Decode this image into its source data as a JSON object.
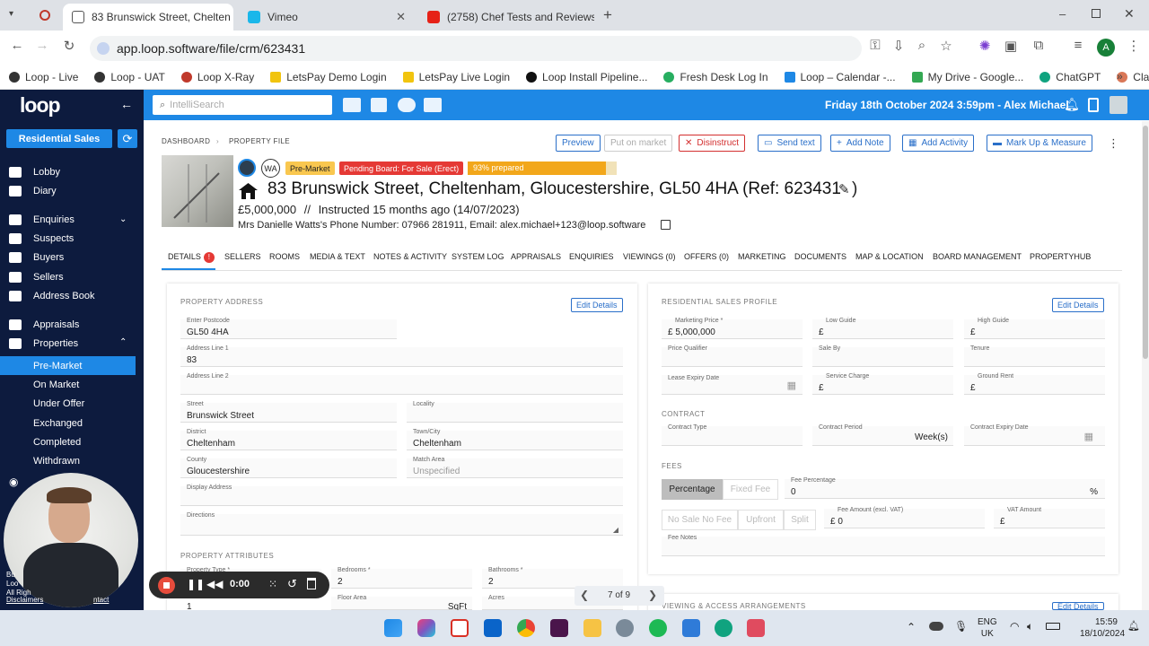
{
  "browser": {
    "tabs": [
      {
        "title": "83 Brunswick Street, Chelten",
        "active": true
      },
      {
        "title": "Vimeo",
        "active": false
      },
      {
        "title": "(2758) Chef Tests and Reviews a",
        "active": false
      }
    ],
    "url": "app.loop.software/file/crm/623431",
    "bookmarks": [
      "Loop - Live",
      "Loop - UAT",
      "Loop X-Ray",
      "LetsPay Demo Login",
      "LetsPay Live Login",
      "Loop Install Pipeline...",
      "Fresh Desk Log In",
      "Loop – Calendar -...",
      "My Drive - Google...",
      "ChatGPT",
      "Claude"
    ],
    "profile_initial": "A"
  },
  "app": {
    "logo": "loop",
    "mode_button": "Residential Sales",
    "search_placeholder": "IntelliSearch",
    "datetime_user": "Friday 18th October 2024 3:59pm - Alex Michael"
  },
  "sidebar": {
    "items": [
      "Lobby",
      "Diary",
      "Enquiries",
      "Suspects",
      "Buyers",
      "Sellers",
      "Address Book",
      "Appraisals",
      "Properties"
    ],
    "subitems": [
      "Pre-Market",
      "On Market",
      "Under Offer",
      "Exchanged",
      "Completed",
      "Withdrawn"
    ],
    "active_subitem": "Pre-Market"
  },
  "breadcrumb": [
    "DASHBOARD",
    "PROPERTY FILE"
  ],
  "actions": [
    "Preview",
    "Put on market",
    "Disinstruct",
    "Send text",
    "Add Note",
    "Add Activity",
    "Mark Up & Measure"
  ],
  "property": {
    "avatar_initials": "WA",
    "badges": [
      "Pre-Market",
      "Pending Board: For Sale (Erect)"
    ],
    "prepared_label": "93% prepared",
    "prepared_pct": 93,
    "title": "83 Brunswick Street, Cheltenham, Gloucestershire, GL50 4HA (Ref: 623431",
    "price": "£5,000,000",
    "instructed": "Instructed 15 months ago (14/07/2023)",
    "contact": "Mrs Danielle Watts's Phone Number: 07966 281911, Email: alex.michael+123@loop.software"
  },
  "tabs": [
    "DETAILS",
    "SELLERS",
    "ROOMS",
    "MEDIA & TEXT",
    "NOTES & ACTIVITY",
    "SYSTEM LOG",
    "APPRAISALS",
    "ENQUIRIES",
    "VIEWINGS (0)",
    "OFFERS (0)",
    "MARKETING",
    "DOCUMENTS",
    "MAP & LOCATION",
    "BOARD MANAGEMENT",
    "PROPERTYHUB"
  ],
  "details_alert": "!",
  "address": {
    "section": "PROPERTY ADDRESS",
    "edit": "Edit Details",
    "postcode_label": "Enter Postcode",
    "postcode": "GL50 4HA",
    "line1_label": "Address Line 1",
    "line1": "83",
    "line2_label": "Address Line 2",
    "line2": "",
    "street_label": "Street",
    "street": "Brunswick Street",
    "locality_label": "Locality",
    "locality": "",
    "district_label": "District",
    "district": "Cheltenham",
    "town_label": "Town/City",
    "town": "Cheltenham",
    "county_label": "County",
    "county": "Gloucestershire",
    "match_label": "Match Area",
    "match": "Unspecified",
    "display_label": "Display Address",
    "directions_label": "Directions"
  },
  "attributes": {
    "section": "PROPERTY ATTRIBUTES",
    "type_label": "Property Type *",
    "type": "1",
    "bedrooms_label": "Bedrooms *",
    "bedrooms": "2",
    "bathrooms_label": "Bathrooms *",
    "bathrooms": "2",
    "floor_label": "Floor Area",
    "floor_unit": "SqFt",
    "acres_label": "Acres"
  },
  "sales_profile": {
    "section": "RESIDENTIAL SALES PROFILE",
    "edit": "Edit Details",
    "mprice_label": "Marketing Price *",
    "mprice": "£ 5,000,000",
    "low_label": "Low Guide",
    "low": "£",
    "high_label": "High Guide",
    "high": "£",
    "qualifier_label": "Price Qualifier",
    "saleby_label": "Sale By",
    "tenure_label": "Tenure",
    "lease_label": "Lease Expiry Date",
    "service_label": "Service Charge",
    "service": "£",
    "ground_label": "Ground Rent",
    "ground": "£"
  },
  "contract": {
    "section": "CONTRACT",
    "type_label": "Contract Type",
    "period_label": "Contract Period",
    "period_unit": "Week(s)",
    "expiry_label": "Contract Expiry Date"
  },
  "fees": {
    "section": "FEES",
    "percentage": "Percentage",
    "fixed": "Fixed Fee",
    "fee_pct_label": "Fee Percentage",
    "fee_pct": "0",
    "pct_sign": "%",
    "options": [
      "No Sale No Fee",
      "Upfront",
      "Split"
    ],
    "amount_label": "Fee Amount (excl. VAT)",
    "amount": "£ 0",
    "vat_label": "VAT Amount",
    "vat": "£",
    "notes_label": "Fee Notes"
  },
  "viewing_section": "VIEWING & ACCESS ARRANGEMENTS",
  "recorder": {
    "time": "0:00",
    "pager": "7 of 9"
  },
  "webcam_text": [
    "Bu",
    "Loo",
    "All Righ",
    "Disclaimers",
    "ntact"
  ],
  "system": {
    "lang1": "ENG",
    "lang2": "UK",
    "time": "15:59",
    "date": "18/10/2024"
  }
}
